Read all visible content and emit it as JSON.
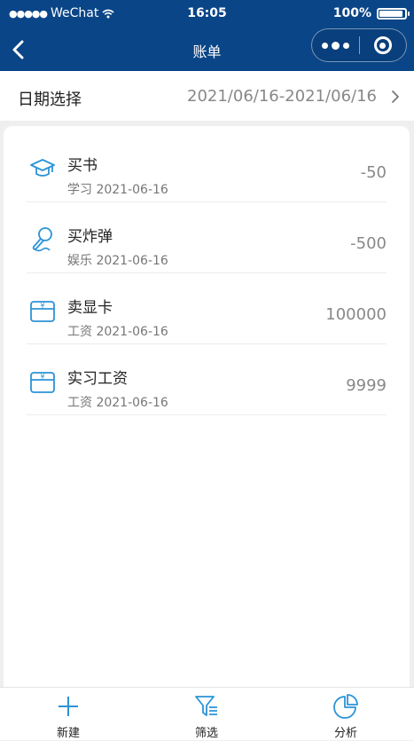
{
  "status_bar": {
    "carrier": "WeChat",
    "time": "16:05",
    "battery": "100%",
    "battery_level": 1.0
  },
  "nav": {
    "title": "账单"
  },
  "date_filter": {
    "label": "日期选择",
    "value": "2021/06/16-2021/06/16"
  },
  "bills": [
    {
      "title": "买书",
      "category": "学习",
      "date": "2021-06-16",
      "amount": "-50",
      "icon": "graduation-cap-icon"
    },
    {
      "title": "买炸弹",
      "category": "娱乐",
      "date": "2021-06-16",
      "amount": "-500",
      "icon": "microphone-icon"
    },
    {
      "title": "卖显卡",
      "category": "工资",
      "date": "2021-06-16",
      "amount": "100000",
      "icon": "salary-box-icon"
    },
    {
      "title": "实习工资",
      "category": "工资",
      "date": "2021-06-16",
      "amount": "9999",
      "icon": "salary-box-icon"
    }
  ],
  "tabs": [
    {
      "label": "新建",
      "icon": "plus-icon"
    },
    {
      "label": "筛选",
      "icon": "filter-icon"
    },
    {
      "label": "分析",
      "icon": "pie-chart-icon"
    }
  ],
  "colors": {
    "brand": "#0a4587",
    "icon": "#2b93d6"
  }
}
